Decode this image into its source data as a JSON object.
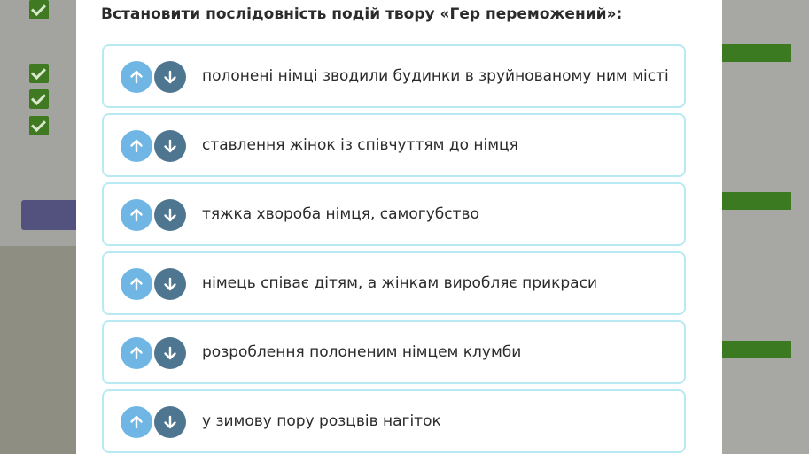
{
  "question": "Встановити послідовність подій твору «Гер переможений»:",
  "items": [
    {
      "text": "полонені німці зводили будинки в зруйнованому ним місті"
    },
    {
      "text": "ставлення жінок із співчуттям до німця"
    },
    {
      "text": "тяжка хвороба німця, самогубство"
    },
    {
      "text": "німець співає дітям, а жінкам виробляє прикраси"
    },
    {
      "text": "розроблення полоненим німцем клумби"
    },
    {
      "text": "у зимову пору розцвів нагіток"
    }
  ],
  "colors": {
    "up_button": "#6fb6e4",
    "down_button": "#4f7690",
    "card_border": "#b8eaf3"
  },
  "icons": {
    "up": "arrow-up-icon",
    "down": "arrow-down-icon"
  }
}
